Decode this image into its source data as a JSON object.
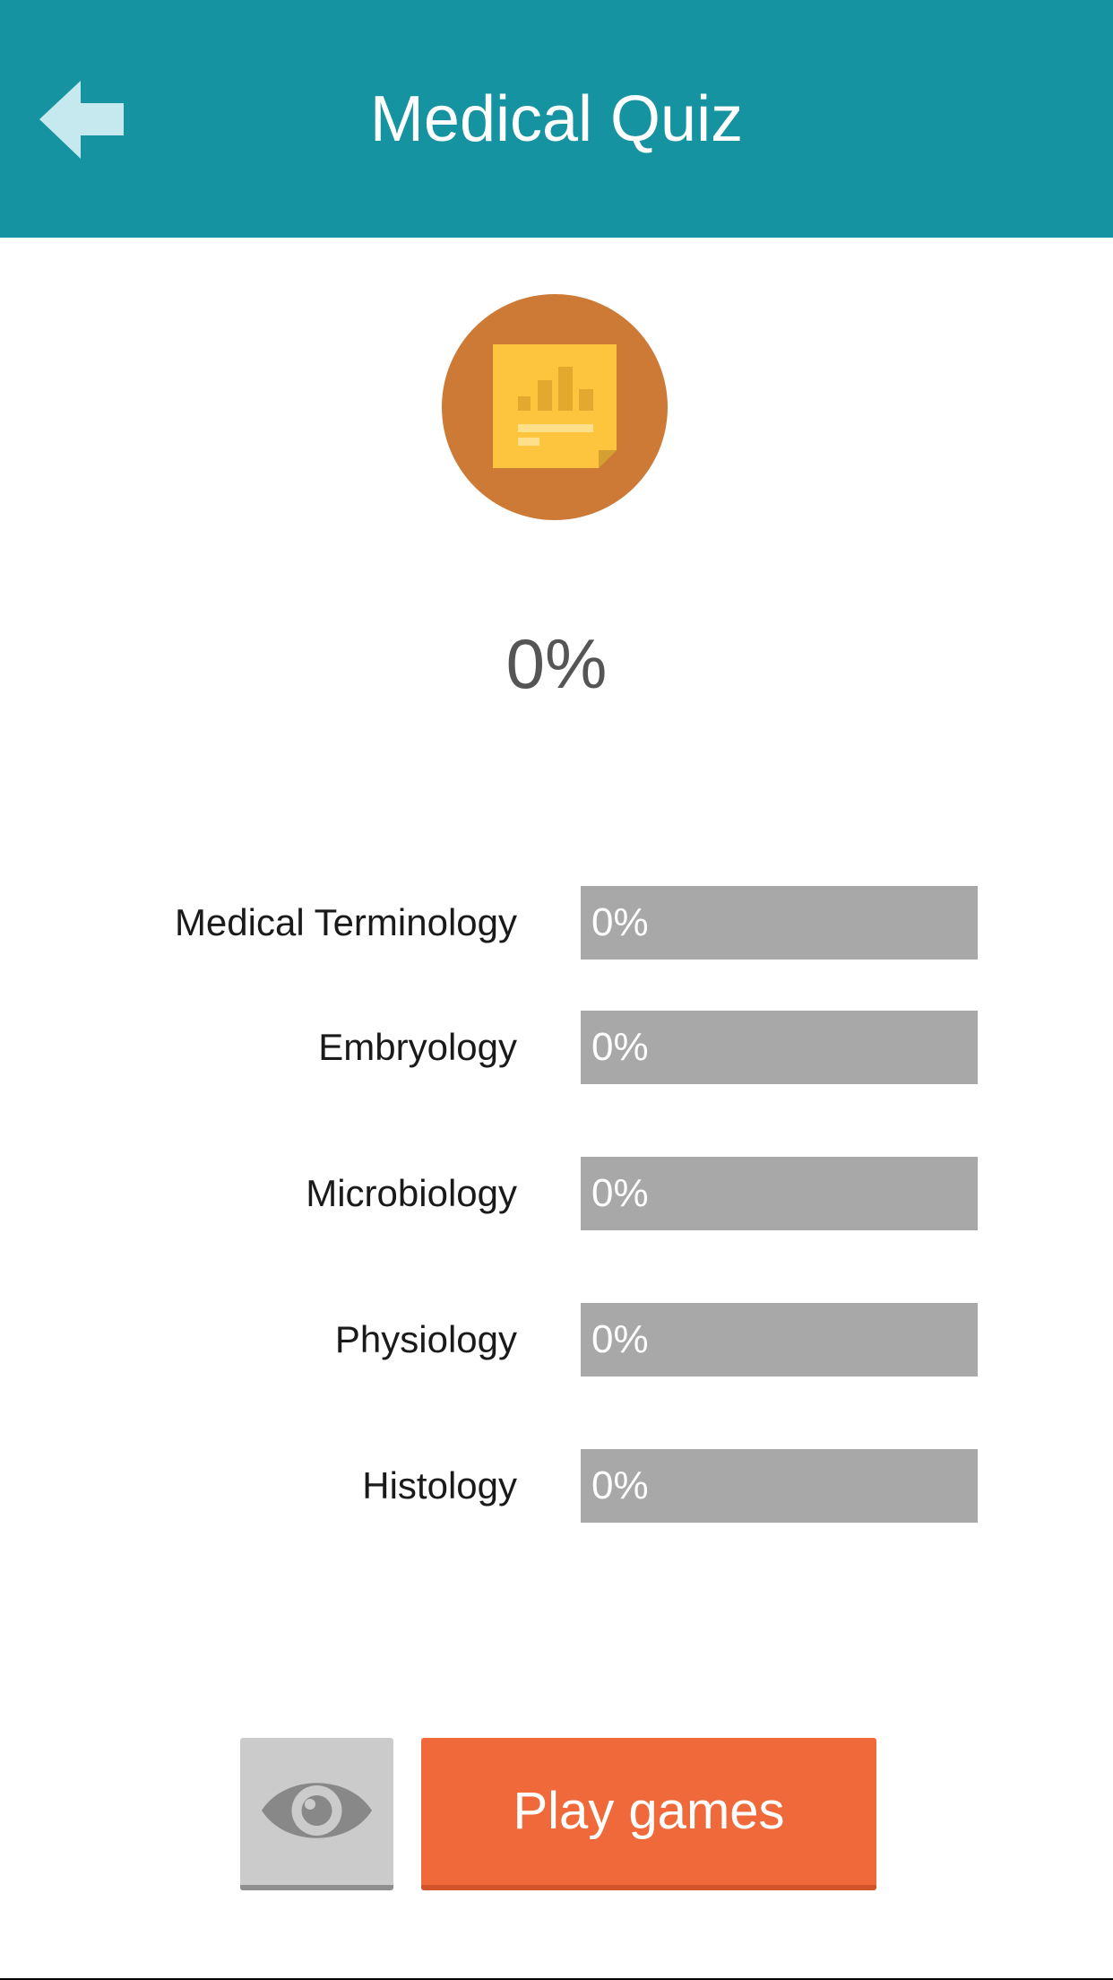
{
  "header": {
    "title": "Medical Quiz",
    "back_icon": "arrow-left-icon",
    "background_color": "#1593a1"
  },
  "badge": {
    "icon": "note-chart-icon",
    "circle_color": "#cc7a35",
    "note_color": "#fdc53e"
  },
  "overall": {
    "progress": 0,
    "label": "0%"
  },
  "categories": [
    {
      "name": "Medical Terminology",
      "progress": 0,
      "label": "0%"
    },
    {
      "name": "Embryology",
      "progress": 0,
      "label": "0%"
    },
    {
      "name": "Microbiology",
      "progress": 0,
      "label": "0%"
    },
    {
      "name": "Physiology",
      "progress": 0,
      "label": "0%"
    },
    {
      "name": "Histology",
      "progress": 0,
      "label": "0%"
    }
  ],
  "actions": {
    "view_icon": "eye-icon",
    "play_label": "Play games",
    "play_color": "#f0693b"
  }
}
